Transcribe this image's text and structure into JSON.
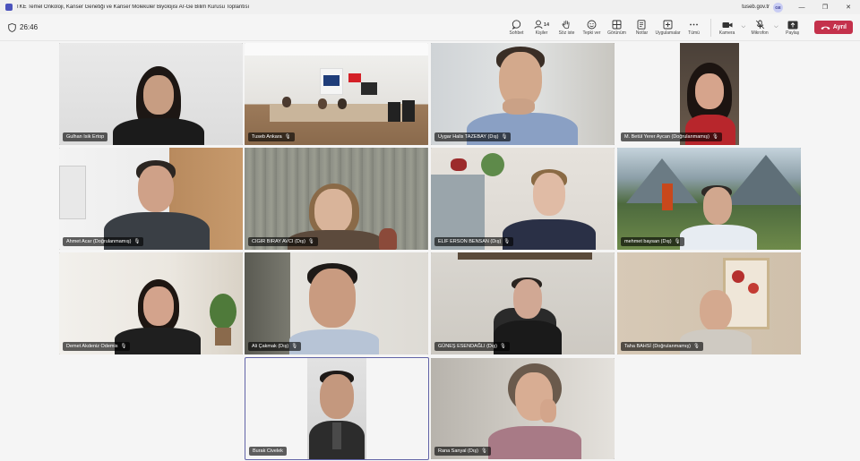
{
  "window": {
    "title": "TKE Temel Onkoloji, Kanser Genetiği ve Kanser Moleküler Biyolojisi Ar-Ge Bilim Kurusu Toplantısı",
    "org": "tuseb.gov.tr",
    "avatar_initials": "GE",
    "minimize": "—",
    "restore": "❐",
    "close": "✕"
  },
  "meeting": {
    "timer": "26:46",
    "people_count": "14",
    "tools": {
      "chat": "Sohbet",
      "people": "Kişiler",
      "raise": "Söz iste",
      "react": "Tepki ver",
      "view": "Görünüm",
      "notes": "Notlar",
      "apps": "Uygulamalar",
      "more": "Tümü",
      "camera": "Kamera",
      "mic": "Mikrofon",
      "share": "Paylaş"
    },
    "leave": "Ayrıl"
  },
  "participants": [
    {
      "name": "Gulhan Isik Ertop"
    },
    {
      "name": "Tuseb Ankara"
    },
    {
      "name": "Uygar Halis TAZEBAY (Dış)"
    },
    {
      "name": "M. Betül Yerer Aycan (Doğrulanmamış)"
    },
    {
      "name": "Ahmet Acar (Doğrulanmamış)"
    },
    {
      "name": "CIGIR BIRAY AVCI (Dış)"
    },
    {
      "name": "ELIF ERSON BENSAN (Dış)"
    },
    {
      "name": "mehmet baysan (Dış)"
    },
    {
      "name": "Demet Akdeniz Odemis"
    },
    {
      "name": "Ali Çakmak (Dış)"
    },
    {
      "name": "GÜNEŞ ESENDAĞLI (Dış)"
    },
    {
      "name": "Taha BAHSİ (Doğrulanmamış)"
    },
    {
      "name": "Burak Civelek"
    },
    {
      "name": "Rana Sanyal (Dış)"
    }
  ],
  "colors": {
    "leave": "#c4314b",
    "accent": "#6264a7"
  }
}
